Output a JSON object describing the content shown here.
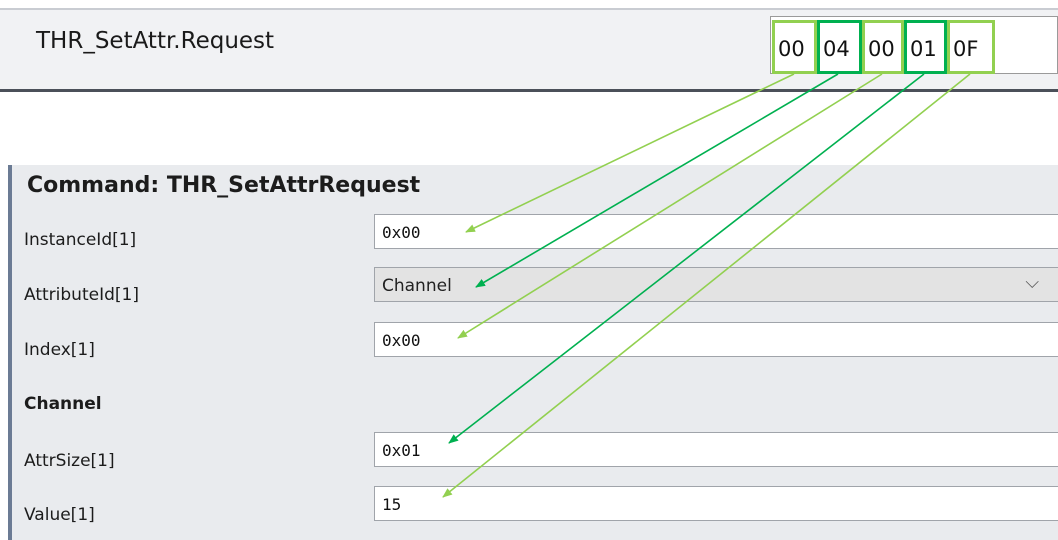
{
  "request": {
    "title": "THR_SetAttr.Request",
    "bytes": [
      "00",
      "04",
      "00",
      "01",
      "0F"
    ]
  },
  "command": {
    "title": "Command: THR_SetAttrRequest",
    "fields": {
      "instance_id": {
        "label": "InstanceId[1]",
        "value": "0x00"
      },
      "attribute_id": {
        "label": "AttributeId[1]",
        "value": "Channel"
      },
      "index": {
        "label": "Index[1]",
        "value": "0x00"
      },
      "attr_size": {
        "label": "AttrSize[1]",
        "value": "0x01"
      },
      "value": {
        "label": "Value[1]",
        "value": "15"
      }
    },
    "section": "Channel"
  },
  "colors": {
    "light_green": "#92d050",
    "dark_green": "#00b050"
  }
}
